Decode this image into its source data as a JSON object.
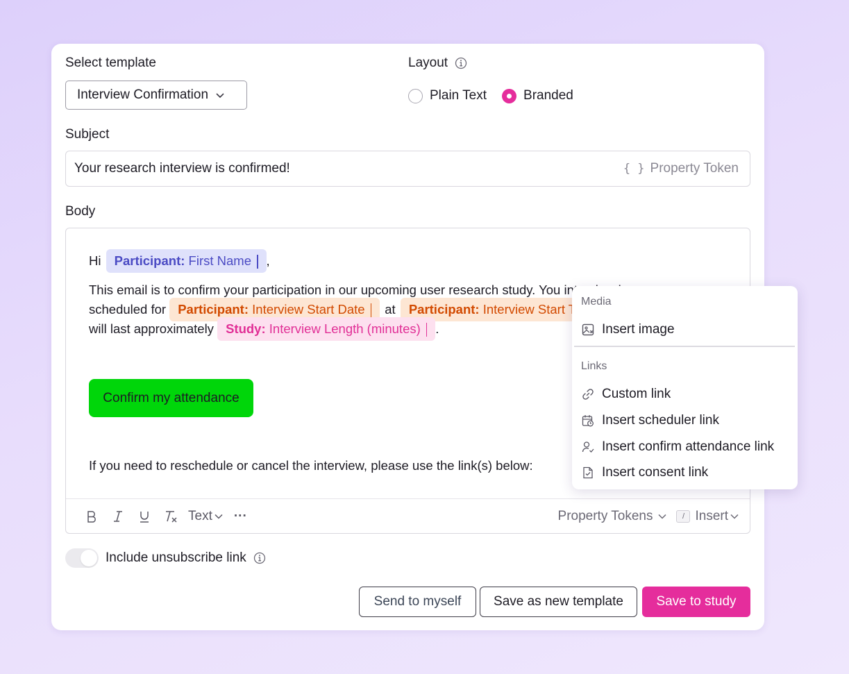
{
  "template": {
    "label": "Select template",
    "selected": "Interview Confirmation"
  },
  "layout": {
    "label": "Layout",
    "options": [
      "Plain Text",
      "Branded"
    ],
    "selected": "Branded"
  },
  "subject": {
    "label": "Subject",
    "value": "Your research interview is confirmed!",
    "token_button": "Property Token",
    "token_glyph": "{ }"
  },
  "body": {
    "label": "Body",
    "greeting": "Hi",
    "greeting_end": ",",
    "chip_first_name": {
      "type": "Participant:",
      "field": "First Name"
    },
    "line2_visible": "This email is to confirm your participation in our upcoming user research study. You interview is",
    "line3_pre": "scheduled for",
    "chip_start_date": {
      "type": "Participant:",
      "field": "Interview Start Date"
    },
    "line3_mid": "at",
    "chip_start_time": {
      "type": "Participant:",
      "field": "Interview Start Time"
    },
    "line4_pre": "will last approximately",
    "chip_length": {
      "type": "Study:",
      "field": "Interview Length (minutes)"
    },
    "line4_end": ".",
    "confirm_button": "Confirm my attendance",
    "footer_line": "If you need to reschedule or cancel the interview, please use the link(s) below:"
  },
  "toolbar": {
    "text_style": "Text",
    "more": "···",
    "property_tokens": "Property Tokens",
    "insert_key": "/",
    "insert": "Insert"
  },
  "unsubscribe": {
    "label": "Include unsubscribe link",
    "enabled": false
  },
  "actions": {
    "send_myself": "Send to myself",
    "save_new": "Save as new template",
    "save_study": "Save to study"
  },
  "insert_menu": {
    "media_heading": "Media",
    "insert_image": "Insert image",
    "links_heading": "Links",
    "custom_link": "Custom link",
    "scheduler_link": "Insert scheduler link",
    "confirm_link": "Insert confirm attendance link",
    "consent_link": "Insert consent link"
  },
  "colors": {
    "brand_pink": "#e52d9c",
    "confirm_green": "#00d60a",
    "chip_blue": "#4b4bc4",
    "chip_orange": "#d24a00"
  }
}
